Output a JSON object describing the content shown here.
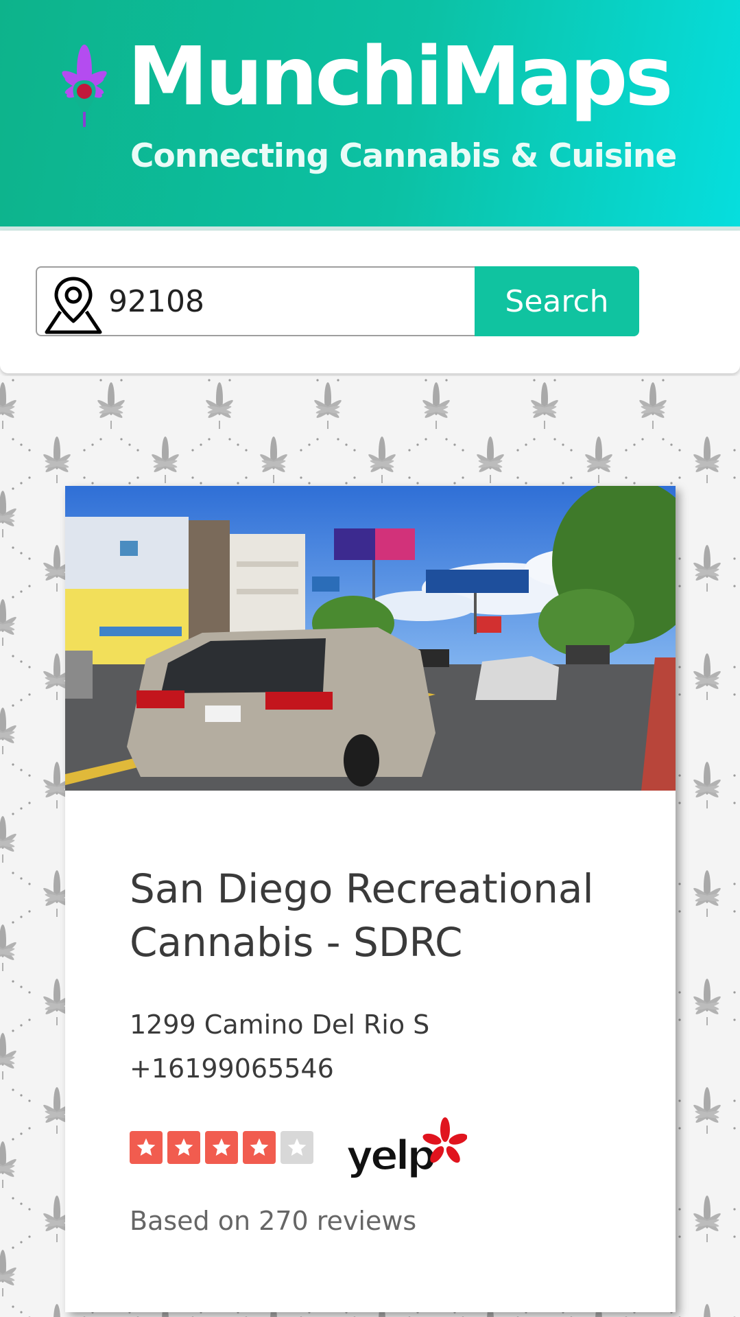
{
  "header": {
    "brand_title": "MunchiMaps",
    "tagline": "Connecting Cannabis & Cuisine",
    "logo_icon": "cannabis-leaf-pin-icon"
  },
  "search": {
    "zip_value": "92108",
    "button_label": "Search",
    "input_icon": "map-pin-icon"
  },
  "result": {
    "name": "San Diego Recreational Cannabis - SDRC",
    "address": "1299 Camino Del Rio S",
    "phone": "+16199065546",
    "rating": 4,
    "rating_max": 5,
    "rating_source": "yelp",
    "review_text": "Based on 270 reviews"
  },
  "colors": {
    "brand_green": "#0db38b",
    "brand_cyan": "#06dede",
    "button": "#10c3a0",
    "star_red": "#f15c4f",
    "logo_purple": "#a855f7"
  }
}
